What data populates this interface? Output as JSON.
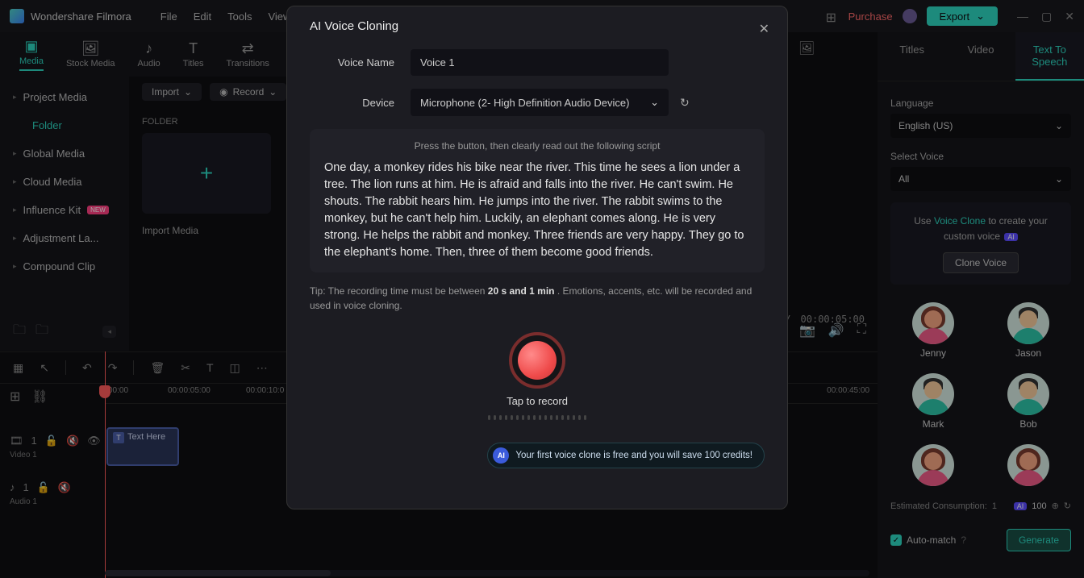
{
  "app": {
    "title": "Wondershare Filmora"
  },
  "menus": [
    "File",
    "Edit",
    "Tools",
    "View"
  ],
  "titlebar": {
    "purchase": "Purchase",
    "export": "Export"
  },
  "topnav": [
    {
      "label": "Media",
      "icon": "▣"
    },
    {
      "label": "Stock Media",
      "icon": "🖼"
    },
    {
      "label": "Audio",
      "icon": "♪"
    },
    {
      "label": "Titles",
      "icon": "T"
    },
    {
      "label": "Transitions",
      "icon": "⇄"
    }
  ],
  "sidebar": {
    "items": [
      {
        "label": "Project Media"
      },
      {
        "label": "Folder",
        "folder": true
      },
      {
        "label": "Global Media"
      },
      {
        "label": "Cloud Media"
      },
      {
        "label": "Influence Kit",
        "badge": "NEW"
      },
      {
        "label": "Adjustment La..."
      },
      {
        "label": "Compound Clip"
      }
    ]
  },
  "media": {
    "import": "Import",
    "record": "Record",
    "folder_heading": "FOLDER",
    "import_media": "Import Media"
  },
  "preview": {
    "time_left": "/",
    "time_right": "00:00:05:00"
  },
  "timeline": {
    "ticks": [
      "00:00",
      "00:00:05:00",
      "00:00:10:0",
      "00:00:45:00"
    ],
    "track1": {
      "label": "Video 1",
      "clip": "Text Here"
    },
    "track2": {
      "label": "Audio 1"
    }
  },
  "rightpanel": {
    "tabs": [
      "Titles",
      "Video",
      "Text To Speech"
    ],
    "language_label": "Language",
    "language_value": "English (US)",
    "voice_label": "Select Voice",
    "voice_filter": "All",
    "clone_prefix": "Use ",
    "clone_link": "Voice Clone",
    "clone_suffix": " to create your custom voice",
    "clone_btn": "Clone Voice",
    "voices": [
      "Jenny",
      "Jason",
      "Mark",
      "Bob"
    ],
    "est_label": "Estimated Consumption:",
    "est_value": "1",
    "credits": "100",
    "automatch": "Auto-match",
    "generate": "Generate"
  },
  "modal": {
    "title": "AI Voice Cloning",
    "voice_name_label": "Voice Name",
    "voice_name_value": "Voice 1",
    "device_label": "Device",
    "device_value": "Microphone (2- High Definition Audio Device)",
    "script_hint": "Press the button, then clearly read out the following script",
    "script": "One day, a monkey rides his bike near the river. This time he sees a lion under a tree. The lion runs at him. He is afraid and falls into the river. He can't swim. He shouts. The rabbit hears him. He jumps into the river. The rabbit swims to the monkey, but he can't help him. Luckily, an elephant comes along. He is very strong. He helps the rabbit and monkey. Three friends are very happy. They go to the elephant's home. Then, three of them become good friends.",
    "tip_prefix": "Tip: The recording time must be between ",
    "tip_bold": "20 s and 1 min",
    "tip_suffix": " . Emotions, accents, etc. will be recorded and used in voice cloning.",
    "record_label": "Tap to record",
    "credit_msg": "Your first voice clone is free and you will save 100 credits!"
  }
}
